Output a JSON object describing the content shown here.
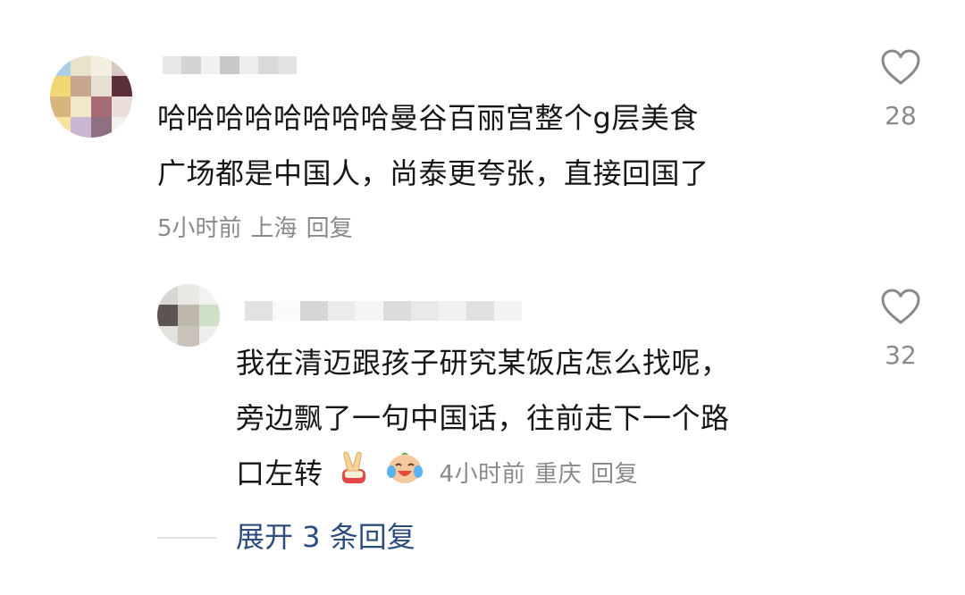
{
  "comment": {
    "author_name": "",
    "text_lines": [
      "哈哈哈哈哈哈哈哈曼谷百丽宫整个g层美食",
      "广场都是中国人，尚泰更夸张，直接回国了"
    ],
    "time": "5小时前",
    "location": "上海",
    "reply_label": "回复",
    "like_count": "28"
  },
  "reply": {
    "author_name": "",
    "text_lines": [
      "我在清迈跟孩子研究某饭店怎么找呢，",
      "旁边飘了一句中国话，往前走下一个路",
      "口左转"
    ],
    "emojis": [
      "victory-hand-emoji",
      "laughing-tears-emoji"
    ],
    "time": "4小时前",
    "location": "重庆",
    "reply_label": "回复",
    "like_count": "32"
  },
  "expand_replies": "展开 3 条回复",
  "colors": {
    "text": "#161616",
    "meta": "#8a8a8a",
    "link": "#2d4c7e",
    "divider": "#e3e3e3"
  }
}
